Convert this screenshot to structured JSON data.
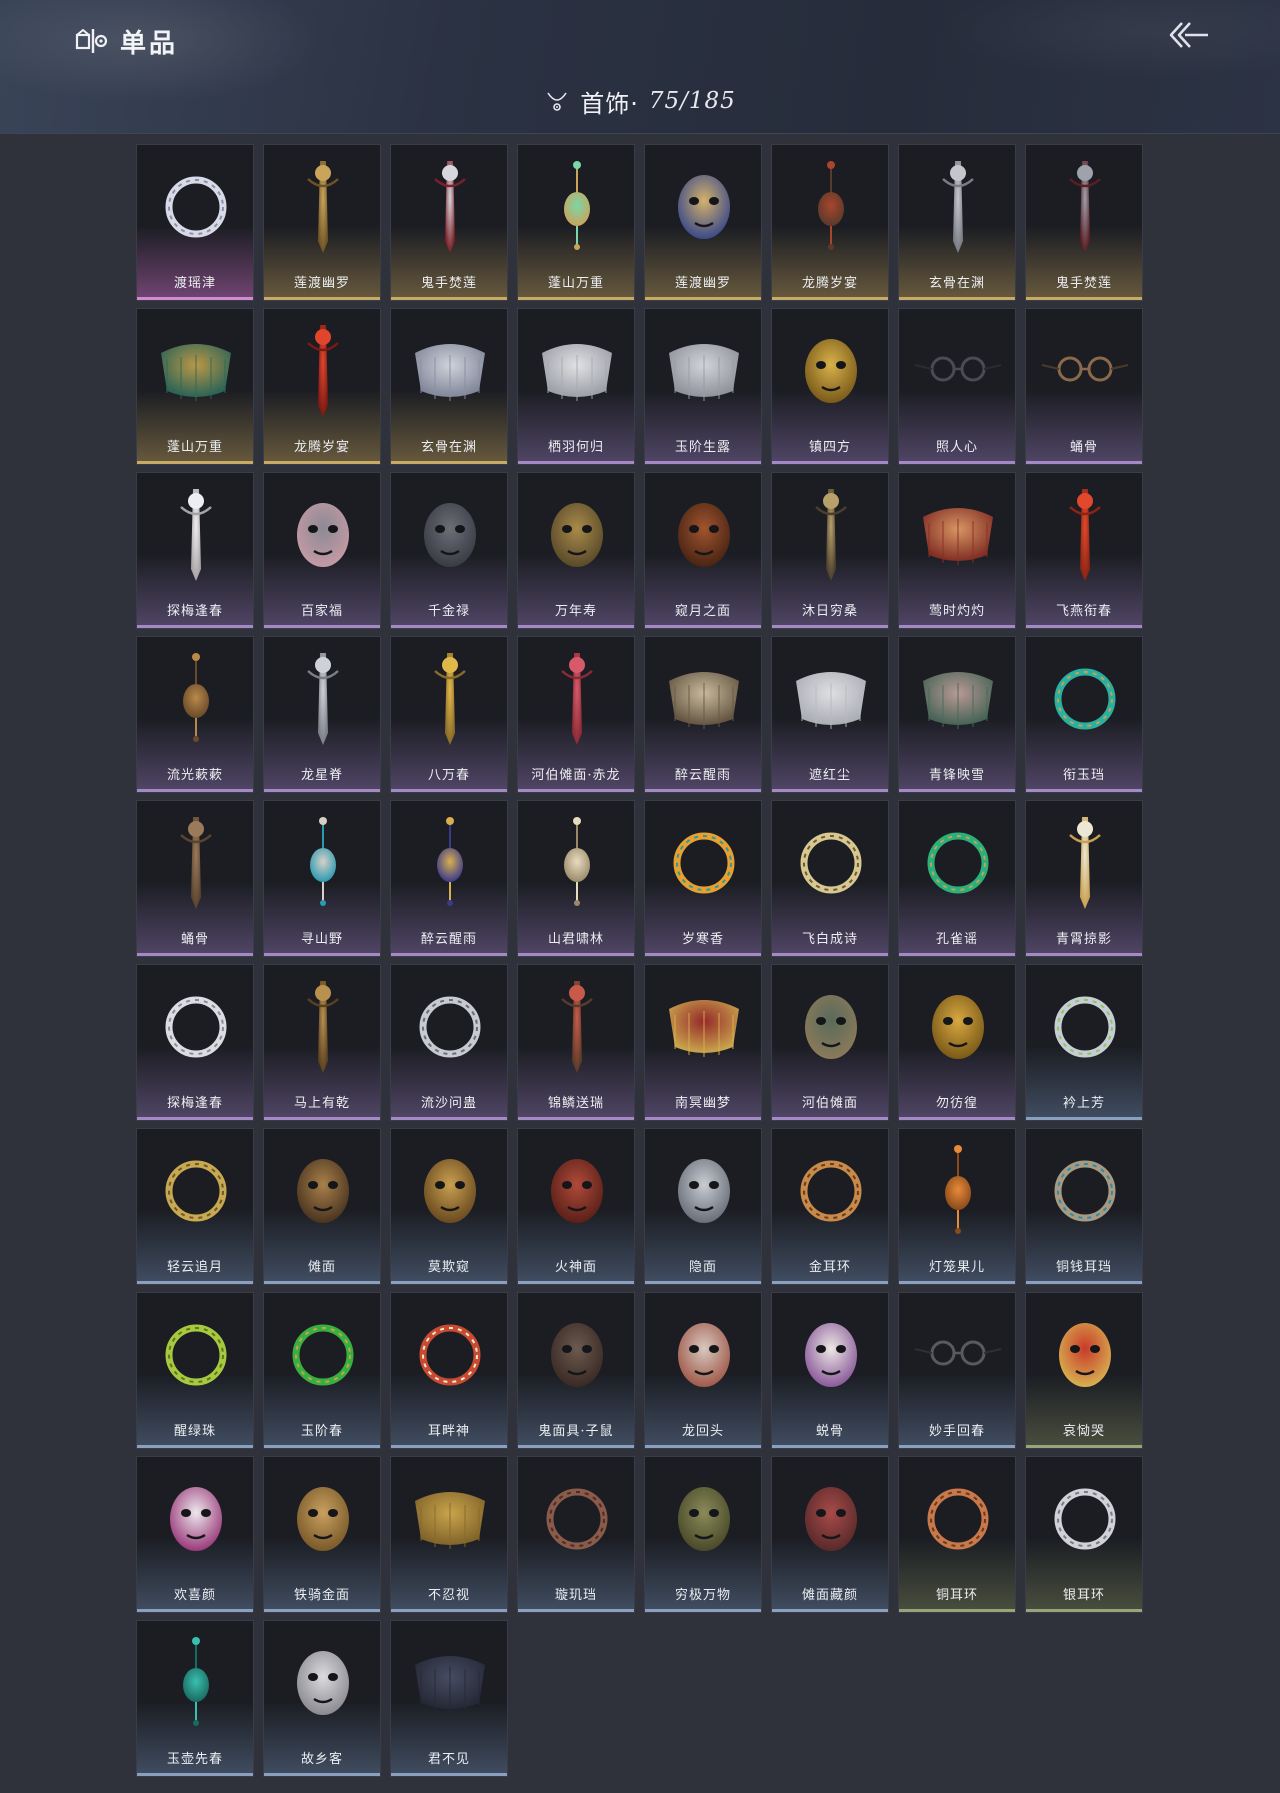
{
  "header": {
    "title": "单品",
    "brand_icon": "wardrobe-icon",
    "back_icon": "back-arrow-icon"
  },
  "category": {
    "icon": "necklace-icon",
    "label": "首饰·",
    "count": "75/185"
  },
  "colors": {
    "background": "#2f323b",
    "card": "#1b1d23",
    "gold": "#c8aa67",
    "purple": "#a38ac4",
    "pink": "#d18bd2",
    "blue": "#8aa0be",
    "olive": "#9aa47a"
  },
  "items": [
    {
      "name": "渡瑶津",
      "rarity": "pink",
      "icon": "feather-earrings",
      "c1": "#d8dae6",
      "c2": "#8a8fae"
    },
    {
      "name": "莲渡幽罗",
      "rarity": "gold",
      "icon": "gold-horn-ornaments",
      "c1": "#c9a45a",
      "c2": "#6e5326"
    },
    {
      "name": "鬼手焚莲",
      "rarity": "gold",
      "icon": "claw-gauntlet",
      "c1": "#d6d6dc",
      "c2": "#7a2028"
    },
    {
      "name": "蓬山万重",
      "rarity": "gold",
      "icon": "jade-pendant",
      "c1": "#7bd6a8",
      "c2": "#c9a45a"
    },
    {
      "name": "莲渡幽罗",
      "rarity": "gold",
      "icon": "gold-medallion-pendant",
      "c1": "#d4b26a",
      "c2": "#3a4a8a"
    },
    {
      "name": "龙腾岁宴",
      "rarity": "gold",
      "icon": "red-tassel-hairpin",
      "c1": "#a8452e",
      "c2": "#5a3a2a"
    },
    {
      "name": "玄骨在渊",
      "rarity": "gold",
      "icon": "silver-hairpin",
      "c1": "#c4c6cc",
      "c2": "#7a7c84"
    },
    {
      "name": "鬼手焚莲",
      "rarity": "gold",
      "icon": "dark-hairpin",
      "c1": "#9ea2ac",
      "c2": "#5a1e24"
    },
    {
      "name": "蓬山万重",
      "rarity": "gold",
      "icon": "jade-gold-crown",
      "c1": "#c9a24a",
      "c2": "#2e6a5a"
    },
    {
      "name": "龙腾岁宴",
      "rarity": "gold",
      "icon": "flame-ornament",
      "c1": "#e0462c",
      "c2": "#7a1a14"
    },
    {
      "name": "玄骨在渊",
      "rarity": "gold",
      "icon": "thorn-circlet",
      "c1": "#dfe2ea",
      "c2": "#8a90a4"
    },
    {
      "name": "栖羽何归",
      "rarity": "purple",
      "icon": "white-wings",
      "c1": "#f2f2f4",
      "c2": "#a8aab4"
    },
    {
      "name": "玉阶生露",
      "rarity": "purple",
      "icon": "bead-veil",
      "c1": "#e2e4ea",
      "c2": "#9a9ca6"
    },
    {
      "name": "镇四方",
      "rarity": "purple",
      "icon": "gold-eye-mask",
      "c1": "#d8b24a",
      "c2": "#7a5a1a"
    },
    {
      "name": "照人心",
      "rarity": "purple",
      "icon": "round-glasses",
      "c1": "#4a4c54",
      "c2": "#2a2c32"
    },
    {
      "name": "蛹骨",
      "rarity": "purple",
      "icon": "branch-glasses",
      "c1": "#8a6a4a",
      "c2": "#4a3a2a"
    },
    {
      "name": "探梅逢春",
      "rarity": "purple",
      "icon": "plum-blossom-branch",
      "c1": "#eceef2",
      "c2": "#a8a2a4"
    },
    {
      "name": "百家福",
      "rarity": "purple",
      "icon": "rat-mask-pink",
      "c1": "#8c8a94",
      "c2": "#c49aa4"
    },
    {
      "name": "千金禄",
      "rarity": "purple",
      "icon": "rat-mask-grey",
      "c1": "#6c6e78",
      "c2": "#3a3c44"
    },
    {
      "name": "万年寿",
      "rarity": "purple",
      "icon": "rat-mask-gold",
      "c1": "#a88a4a",
      "c2": "#5a4a2a"
    },
    {
      "name": "窥月之面",
      "rarity": "purple",
      "icon": "lion-mask",
      "c1": "#a0552e",
      "c2": "#4a2414"
    },
    {
      "name": "沐日穷桑",
      "rarity": "purple",
      "icon": "dragon-hairpin",
      "c1": "#b8a06a",
      "c2": "#4a3e2e"
    },
    {
      "name": "莺时灼灼",
      "rarity": "purple",
      "icon": "crimson-veil",
      "c1": "#e8a06a",
      "c2": "#8a3024"
    },
    {
      "name": "飞燕衔春",
      "rarity": "purple",
      "icon": "red-swallow-ornament",
      "c1": "#e2482c",
      "c2": "#8a2414"
    },
    {
      "name": "流光蔌蔌",
      "rarity": "purple",
      "icon": "gold-tassel",
      "c1": "#b88a4a",
      "c2": "#6a4a2a"
    },
    {
      "name": "龙星脊",
      "rarity": "purple",
      "icon": "silver-spine-hairpin",
      "c1": "#cfd1d8",
      "c2": "#7a7c86"
    },
    {
      "name": "八万春",
      "rarity": "purple",
      "icon": "gold-flower-hairpin",
      "c1": "#e0b84a",
      "c2": "#8a6a2a"
    },
    {
      "name": "河伯傩面·赤龙",
      "rarity": "purple",
      "icon": "red-lotus-antlers",
      "c1": "#d65a6a",
      "c2": "#8a2a34"
    },
    {
      "name": "醉云醒雨",
      "rarity": "purple",
      "icon": "pearl-chain-circlet",
      "c1": "#d8c8a8",
      "c2": "#6a5a44"
    },
    {
      "name": "遮红尘",
      "rarity": "purple",
      "icon": "white-headband",
      "c1": "#f0f0f2",
      "c2": "#b8bac2"
    },
    {
      "name": "青锋映雪",
      "rarity": "purple",
      "icon": "embroidered-veil",
      "c1": "#c8a4a0",
      "c2": "#4a6a5a"
    },
    {
      "name": "衔玉珰",
      "rarity": "purple",
      "icon": "teal-ring-earring",
      "c1": "#2ab0a0",
      "c2": "#c8a050"
    },
    {
      "name": "蛹骨",
      "rarity": "purple",
      "icon": "bone-hook",
      "c1": "#9a7a5a",
      "c2": "#5a4430"
    },
    {
      "name": "寻山野",
      "rarity": "purple",
      "icon": "silver-locket",
      "c1": "#d8d0c8",
      "c2": "#2a9ab0"
    },
    {
      "name": "醉云醒雨",
      "rarity": "purple",
      "icon": "gold-tassel-pin",
      "c1": "#d8b050",
      "c2": "#3a3a8a"
    },
    {
      "name": "山君啸林",
      "rarity": "purple",
      "icon": "bone-amulet",
      "c1": "#e8dcc0",
      "c2": "#9a8a6a"
    },
    {
      "name": "岁寒香",
      "rarity": "purple",
      "icon": "gourd-earring",
      "c1": "#e8a030",
      "c2": "#2a9aa0"
    },
    {
      "name": "飞白成诗",
      "rarity": "purple",
      "icon": "crescent-dagger-earring",
      "c1": "#d8c890",
      "c2": "#6a5a3a"
    },
    {
      "name": "孔雀谣",
      "rarity": "purple",
      "icon": "emerald-earring",
      "c1": "#2ab07a",
      "c2": "#c8a050"
    },
    {
      "name": "青霄掠影",
      "rarity": "purple",
      "icon": "feather-cuff",
      "c1": "#ece6d4",
      "c2": "#c8a050"
    },
    {
      "name": "探梅逢春",
      "rarity": "purple",
      "icon": "feather-tassel-earring",
      "c1": "#dcdde2",
      "c2": "#8a8c96"
    },
    {
      "name": "马上有乾",
      "rarity": "purple",
      "icon": "gold-horn-cuff",
      "c1": "#b89050",
      "c2": "#5a4020"
    },
    {
      "name": "流沙问蛊",
      "rarity": "purple",
      "icon": "silver-spike-earring",
      "c1": "#c8cad2",
      "c2": "#6a6c76"
    },
    {
      "name": "锦鳞送瑞",
      "rarity": "purple",
      "icon": "red-bead-chain",
      "c1": "#c85a4a",
      "c2": "#5a3a2a"
    },
    {
      "name": "南冥幽梦",
      "rarity": "purple",
      "icon": "red-gold-veil",
      "c1": "#a02a2a",
      "c2": "#d8b050"
    },
    {
      "name": "河伯傩面",
      "rarity": "purple",
      "icon": "horned-demon-mask",
      "c1": "#5a6a5a",
      "c2": "#8a7a5a"
    },
    {
      "name": "勿彷徨",
      "rarity": "purple",
      "icon": "gold-half-mask",
      "c1": "#d8a840",
      "c2": "#7a5a18"
    },
    {
      "name": "衿上芳",
      "rarity": "blue",
      "icon": "jade-bangle-leaf",
      "c1": "#c8ccd4",
      "c2": "#8ac860"
    },
    {
      "name": "轻云追月",
      "rarity": "blue",
      "icon": "serpent-bangle",
      "c1": "#c8a850",
      "c2": "#6a5a2a"
    },
    {
      "name": "傩面",
      "rarity": "blue",
      "icon": "bearded-warrior-mask",
      "c1": "#a8804a",
      "c2": "#4a3420"
    },
    {
      "name": "莫欺窥",
      "rarity": "blue",
      "icon": "gold-crown-mask",
      "c1": "#c8a050",
      "c2": "#6a4a20"
    },
    {
      "name": "火神面",
      "rarity": "blue",
      "icon": "red-demon-mask",
      "c1": "#b04a3a",
      "c2": "#5a2018"
    },
    {
      "name": "隐面",
      "rarity": "blue",
      "icon": "silver-face-mask",
      "c1": "#c8ccd2",
      "c2": "#6a6e78"
    },
    {
      "name": "金耳环",
      "rarity": "blue",
      "icon": "bronze-hoop",
      "c1": "#c88a4a",
      "c2": "#6a3a1a"
    },
    {
      "name": "灯笼果儿",
      "rarity": "blue",
      "icon": "orange-lantern-fruit",
      "c1": "#e88a3a",
      "c2": "#8a4a1a"
    },
    {
      "name": "铜钱耳珰",
      "rarity": "blue",
      "icon": "coin-earring",
      "c1": "#a89a80",
      "c2": "#2a8ab0"
    },
    {
      "name": "醒绿珠",
      "rarity": "blue",
      "icon": "green-grape-earring",
      "c1": "#a8c840",
      "c2": "#5a7a1a"
    },
    {
      "name": "玉阶春",
      "rarity": "blue",
      "icon": "green-bead-earring",
      "c1": "#38b040",
      "c2": "#c8a050"
    },
    {
      "name": "耳畔神",
      "rarity": "blue",
      "icon": "pearl-drop-earring",
      "c1": "#c84a30",
      "c2": "#f0ecd8"
    },
    {
      "name": "鬼面具·子鼠",
      "rarity": "blue",
      "icon": "rat-demon-mask",
      "c1": "#6a5a50",
      "c2": "#3a2a24"
    },
    {
      "name": "龙回头",
      "rarity": "blue",
      "icon": "dragon-face-mask",
      "c1": "#d8c8c0",
      "c2": "#a05a4a"
    },
    {
      "name": "蜕骨",
      "rarity": "blue",
      "icon": "opera-white-mask",
      "c1": "#ece8e4",
      "c2": "#8a5a9a"
    },
    {
      "name": "妙手回春",
      "rarity": "blue",
      "icon": "wire-glasses",
      "c1": "#5a5a5e",
      "c2": "#2e3034"
    },
    {
      "name": "哀恸哭",
      "rarity": "olive",
      "icon": "red-opera-mask",
      "c1": "#c83a2a",
      "c2": "#d8b050"
    },
    {
      "name": "欢喜颜",
      "rarity": "blue",
      "icon": "grinning-white-mask",
      "c1": "#ece8ec",
      "c2": "#9a3a7a"
    },
    {
      "name": "铁骑金面",
      "rarity": "blue",
      "icon": "gold-face-mask",
      "c1": "#c8a060",
      "c2": "#7a5a2a"
    },
    {
      "name": "不忍视",
      "rarity": "blue",
      "icon": "gold-headdress-veil",
      "c1": "#d8b050",
      "c2": "#8a6a2a"
    },
    {
      "name": "璇玑珰",
      "rarity": "blue",
      "icon": "gear-ring",
      "c1": "#8a5a4a",
      "c2": "#4a2e24"
    },
    {
      "name": "穷极万物",
      "rarity": "blue",
      "icon": "bronze-taotie-mask",
      "c1": "#8a8a5a",
      "c2": "#4a4a2a"
    },
    {
      "name": "傩面藏颜",
      "rarity": "blue",
      "icon": "feathered-red-mask",
      "c1": "#a84a4a",
      "c2": "#5a2a2a"
    },
    {
      "name": "铜耳环",
      "rarity": "olive",
      "icon": "copper-hoop",
      "c1": "#c8784a",
      "c2": "#6a3a1a"
    },
    {
      "name": "银耳环",
      "rarity": "olive",
      "icon": "silver-hoop",
      "c1": "#d0d2d8",
      "c2": "#7a7c84"
    },
    {
      "name": "玉壶先春",
      "rarity": "blue",
      "icon": "teal-vase",
      "c1": "#3ac0b0",
      "c2": "#1a6a60"
    },
    {
      "name": "故乡客",
      "rarity": "blue",
      "icon": "white-stone-mask",
      "c1": "#dcdcde",
      "c2": "#8a8a90"
    },
    {
      "name": "君不见",
      "rarity": "blue",
      "icon": "dark-face-veil",
      "c1": "#4a5068",
      "c2": "#262a38"
    }
  ]
}
